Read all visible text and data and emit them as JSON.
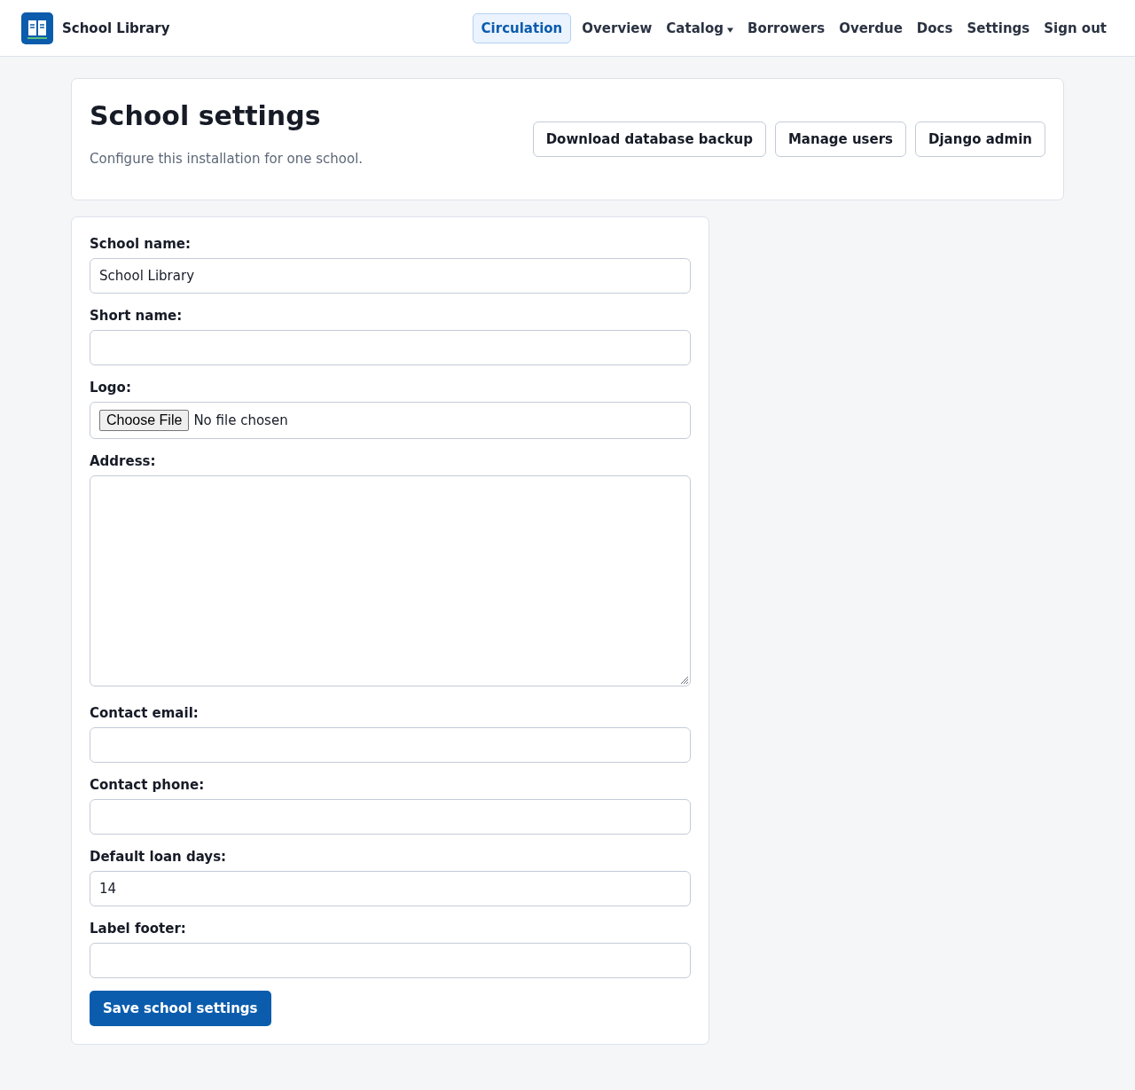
{
  "header": {
    "brand": "School Library",
    "nav": [
      {
        "label": "Circulation",
        "kind": "link",
        "selected": true
      },
      {
        "label": "Overview",
        "kind": "link",
        "selected": false
      },
      {
        "label": "Catalog",
        "kind": "menu",
        "selected": false
      },
      {
        "label": "Borrowers",
        "kind": "link",
        "selected": false
      },
      {
        "label": "Overdue",
        "kind": "link",
        "selected": false
      },
      {
        "label": "Docs",
        "kind": "link",
        "selected": false
      },
      {
        "label": "Settings",
        "kind": "link",
        "selected": false
      },
      {
        "label": "Sign out",
        "kind": "link",
        "selected": false
      }
    ]
  },
  "page_header": {
    "title": "School settings",
    "subtitle": "Configure this installation for one school.",
    "buttons": [
      "Download database backup",
      "Manage users",
      "Django admin"
    ]
  },
  "form": {
    "fields": [
      {
        "label": "School name:",
        "kind": "text",
        "value": "School Library"
      },
      {
        "label": "Short name:",
        "kind": "text"
      },
      {
        "label": "Logo:",
        "kind": "file",
        "button": "Choose File",
        "status": "No file chosen"
      },
      {
        "label": "Address:",
        "kind": "textarea"
      },
      {
        "label": "Contact email:",
        "kind": "text"
      },
      {
        "label": "Contact phone:",
        "kind": "text"
      },
      {
        "label": "Default loan days:",
        "kind": "text",
        "value": "14"
      },
      {
        "label": "Label footer:",
        "kind": "text"
      }
    ],
    "submit": "Save school settings"
  }
}
